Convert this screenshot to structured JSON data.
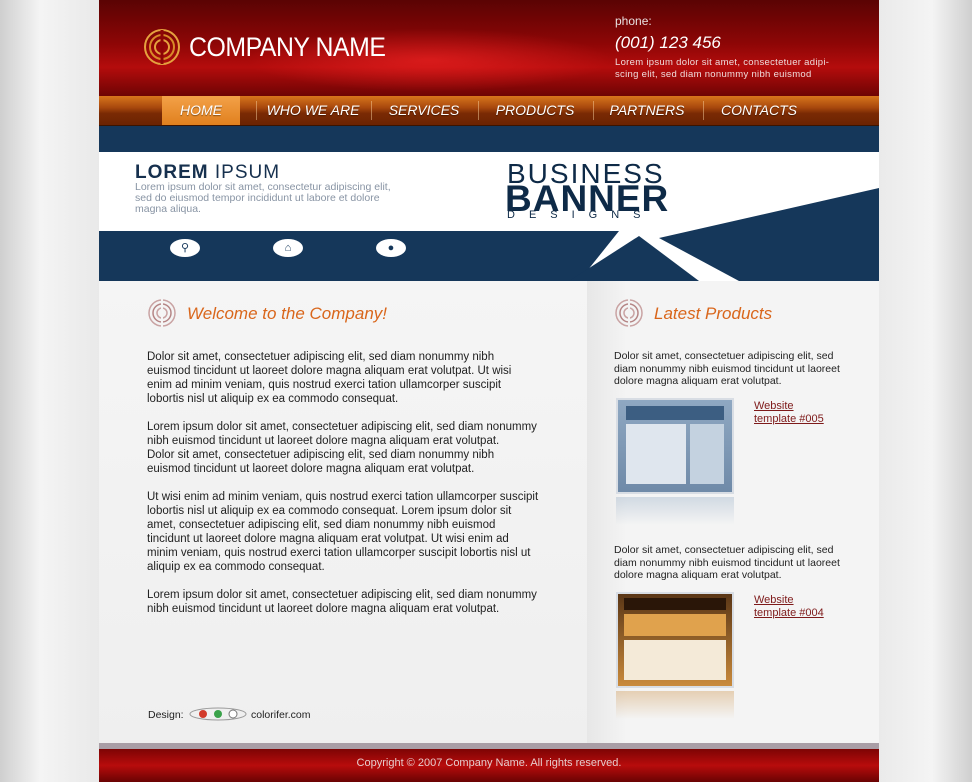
{
  "header": {
    "company_name": "COMPANY NAME",
    "phone_label": "phone:",
    "phone_number": "(001) 123 456",
    "blurb": "Lorem ipsum dolor sit amet, consectetuer adipi-scing elit, sed diam nonummy nibh euismod"
  },
  "nav": {
    "items": [
      {
        "label": "HOME",
        "active": true
      },
      {
        "label": "WHO WE ARE",
        "active": false
      },
      {
        "label": "SERVICES",
        "active": false
      },
      {
        "label": "PRODUCTS",
        "active": false
      },
      {
        "label": "PARTNERS",
        "active": false
      },
      {
        "label": "CONTACTS",
        "active": false
      }
    ]
  },
  "banner": {
    "headline_bold": "LOREM",
    "headline_light": " IPSUM",
    "text": "Lorem ipsum dolor sit amet, consectetur adipiscing elit, sed do eiusmod tempor incididunt ut labore et dolore magna aliqua.",
    "line1": "BUSINESS",
    "line2": "BANNER",
    "line3": "DESIGNS"
  },
  "main": {
    "title": "Welcome to the Company!",
    "paragraphs": [
      "Dolor sit amet, consectetuer adipiscing elit, sed diam nonummy nibh euismod tincidunt ut laoreet dolore magna aliquam erat volutpat. Ut wisi enim ad minim veniam, quis nostrud exerci tation ullamcorper suscipit lobortis nisl ut aliquip ex ea commodo consequat.",
      "Lorem ipsum dolor sit amet, consectetuer adipiscing elit, sed diam nonummy nibh euismod tincidunt ut laoreet dolore magna aliquam erat volutpat.",
      "Dolor sit amet, consectetuer adipiscing elit, sed diam nonummy nibh euismod tincidunt ut laoreet dolore magna aliquam erat volutpat.",
      "Ut wisi enim ad minim veniam, quis nostrud exerci tation ullamcorper suscipit lobortis nisl ut aliquip ex ea commodo consequat. Lorem ipsum dolor sit amet, consectetuer adipiscing elit, sed diam nonummy nibh euismod tincidunt ut laoreet dolore magna aliquam erat volutpat. Ut wisi enim ad minim veniam, quis nostrud exerci tation ullamcorper suscipit lobortis nisl ut aliquip ex ea commodo consequat.",
      "Lorem ipsum dolor sit amet, consectetuer adipiscing elit, sed diam nonummy nibh euismod tincidunt ut laoreet dolore magna aliquam erat volutpat."
    ],
    "design_label": "Design:",
    "design_credit": "colorifer.com"
  },
  "side": {
    "title": "Latest Products",
    "products": [
      {
        "text": "Dolor sit amet, consectetuer adipiscing elit, sed diam nonummy nibh euismod tincidunt ut laoreet dolore magna aliquam erat volutpat.",
        "link": "Website template #005"
      },
      {
        "text": "Dolor sit amet, consectetuer adipiscing elit, sed diam nonummy nibh euismod tincidunt ut laoreet dolore magna aliquam erat volutpat.",
        "link": "Website template #004"
      }
    ]
  },
  "footer": {
    "copyright": "Copyright © 2007 Company Name. All rights reserved."
  },
  "colors": {
    "header_red": "#8d0606",
    "nav_orange": "#d8751c",
    "title_orange": "#d9661b",
    "link_red": "#7e1a1a",
    "banner_navy": "#15375a"
  }
}
